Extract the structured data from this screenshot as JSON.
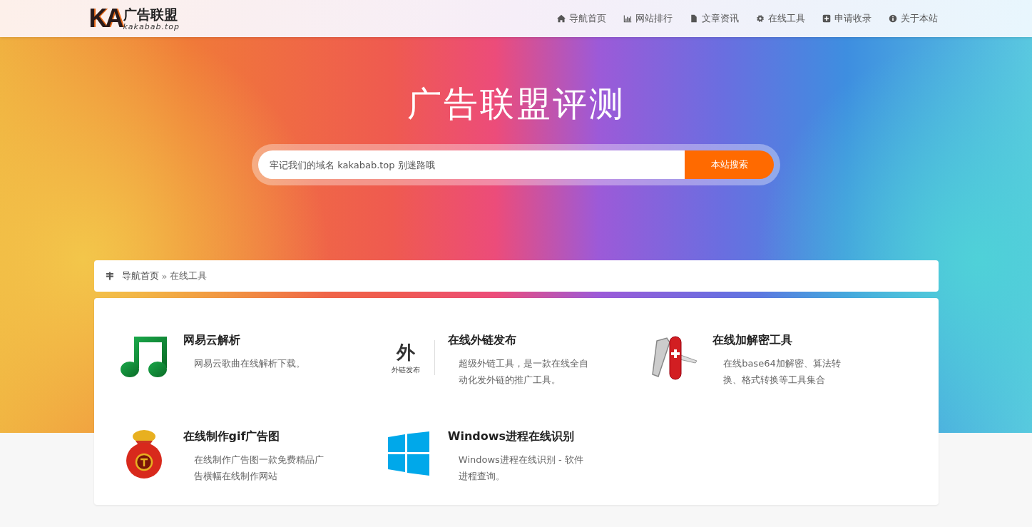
{
  "logo": {
    "mark": "KA",
    "title": "广告联盟",
    "domain": "kakabab.top"
  },
  "nav": [
    {
      "kind": "home",
      "label": "导航首页"
    },
    {
      "kind": "chart",
      "label": "网站排行"
    },
    {
      "kind": "file",
      "label": "文章资讯"
    },
    {
      "kind": "gear",
      "label": "在线工具"
    },
    {
      "kind": "plus",
      "label": "申请收录"
    },
    {
      "kind": "info",
      "label": "关于本站"
    }
  ],
  "hero": {
    "title": "广告联盟评测",
    "search": {
      "placeholder": "牢记我们的域名 kakabab.top 别迷路哦",
      "button": "本站搜索"
    }
  },
  "breadcrumb": {
    "items": [
      "导航首页",
      "在线工具"
    ],
    "separator": "»"
  },
  "tools": [
    {
      "kind": "music",
      "title": "网易云解析",
      "description": "网易云歌曲在线解析下载。"
    },
    {
      "kind": "text-logo",
      "logo_char": "外",
      "logo_caption": "外链发布",
      "title": "在线外链发布",
      "description": "超级外链工具，是一款在线全自动化发外链的推广工具。"
    },
    {
      "kind": "knife",
      "title": "在线加解密工具",
      "description": "在线base64加解密、算法转换、格式转换等工具集合"
    },
    {
      "kind": "bag",
      "title": "在线制作gif广告图",
      "description": "在线制作广告图一款免费精品广告横幅在线制作网站"
    },
    {
      "kind": "windows",
      "title": "Windows进程在线识别",
      "description": "Windows进程在线识别 - 软件进程查询。"
    }
  ]
}
